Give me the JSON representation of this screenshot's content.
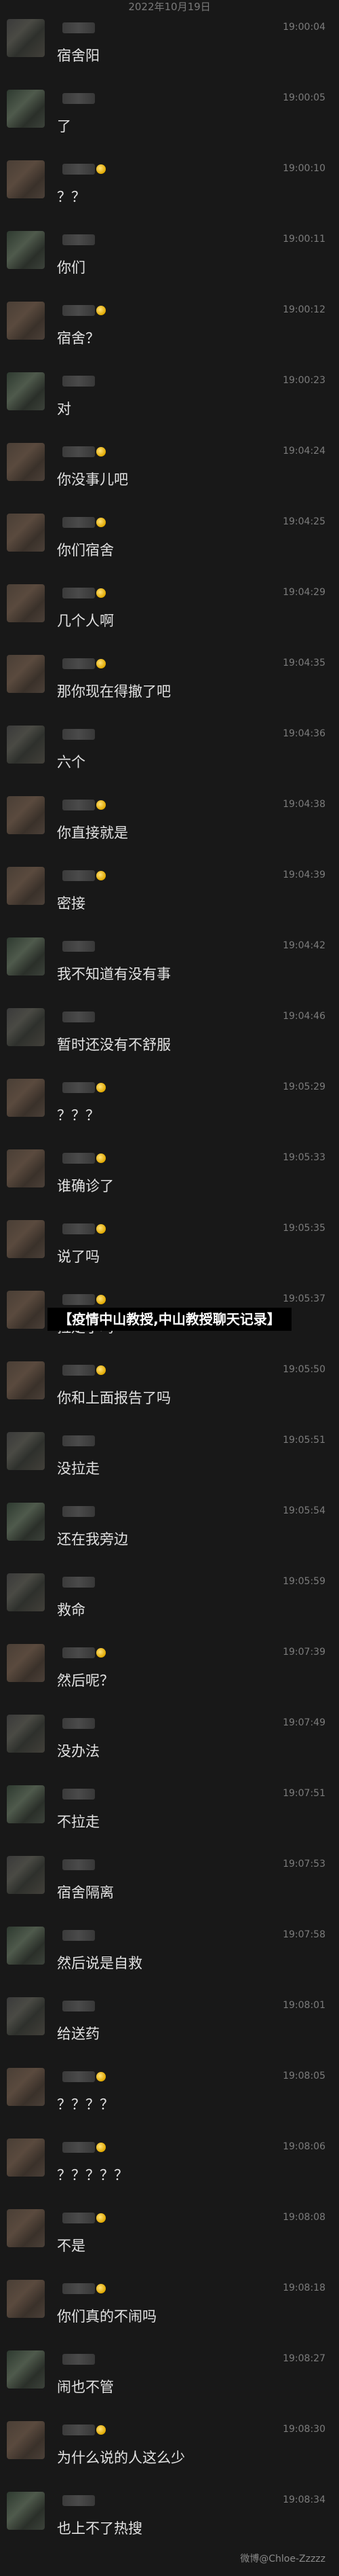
{
  "date_header": "2022年10月19日",
  "messages": [
    {
      "time": "19:00:04",
      "text": "宿舍阳",
      "emoji": false
    },
    {
      "time": "19:00:05",
      "text": "了",
      "emoji": false
    },
    {
      "time": "19:00:10",
      "text": "？？",
      "emoji": true
    },
    {
      "time": "19:00:11",
      "text": "你们",
      "emoji": false
    },
    {
      "time": "19:00:12",
      "text": "宿舍？",
      "emoji": true
    },
    {
      "time": "19:00:23",
      "text": "对",
      "emoji": false
    },
    {
      "time": "19:04:24",
      "text": "你没事儿吧",
      "emoji": true
    },
    {
      "time": "19:04:25",
      "text": "你们宿舍",
      "emoji": true
    },
    {
      "time": "19:04:29",
      "text": "几个人啊",
      "emoji": true
    },
    {
      "time": "19:04:35",
      "text": "那你现在得撤了吧",
      "emoji": true
    },
    {
      "time": "19:04:36",
      "text": "六个",
      "emoji": false
    },
    {
      "time": "19:04:38",
      "text": "你直接就是",
      "emoji": true
    },
    {
      "time": "19:04:39",
      "text": "密接",
      "emoji": true
    },
    {
      "time": "19:04:42",
      "text": "我不知道有没有事",
      "emoji": false
    },
    {
      "time": "19:04:46",
      "text": "暂时还没有不舒服",
      "emoji": false
    },
    {
      "time": "19:05:29",
      "text": "？？？",
      "emoji": true
    },
    {
      "time": "19:05:33",
      "text": "谁确诊了",
      "emoji": true
    },
    {
      "time": "19:05:35",
      "text": "说了吗",
      "emoji": true
    },
    {
      "time": "19:05:37",
      "text": "拉走了吗",
      "emoji": true
    },
    {
      "time": "19:05:50",
      "text": "你和上面报告了吗",
      "emoji": true
    },
    {
      "time": "19:05:51",
      "text": "没拉走",
      "emoji": false
    },
    {
      "time": "19:05:54",
      "text": "还在我旁边",
      "emoji": false
    },
    {
      "time": "19:05:59",
      "text": "救命",
      "emoji": false
    },
    {
      "time": "19:07:39",
      "text": "然后呢？",
      "emoji": true
    },
    {
      "time": "19:07:49",
      "text": "没办法",
      "emoji": false
    },
    {
      "time": "19:07:51",
      "text": "不拉走",
      "emoji": false
    },
    {
      "time": "19:07:53",
      "text": "宿舍隔离",
      "emoji": false
    },
    {
      "time": "19:07:58",
      "text": "然后说是自救",
      "emoji": false
    },
    {
      "time": "19:08:01",
      "text": "给送药",
      "emoji": false
    },
    {
      "time": "19:08:05",
      "text": "？？？？",
      "emoji": true
    },
    {
      "time": "19:08:06",
      "text": "？？？？？",
      "emoji": true
    },
    {
      "time": "19:08:08",
      "text": "不是",
      "emoji": true
    },
    {
      "time": "19:08:18",
      "text": "你们真的不闹吗",
      "emoji": true
    },
    {
      "time": "19:08:27",
      "text": "闹也不管",
      "emoji": false
    },
    {
      "time": "19:08:30",
      "text": "为什么说的人这么少",
      "emoji": true
    },
    {
      "time": "19:08:34",
      "text": "也上不了热搜",
      "emoji": false
    }
  ],
  "overlay_title": "【疫情中山教授,中山教授聊天记录】",
  "watermark": "微博@Chloe-Zzzzz"
}
